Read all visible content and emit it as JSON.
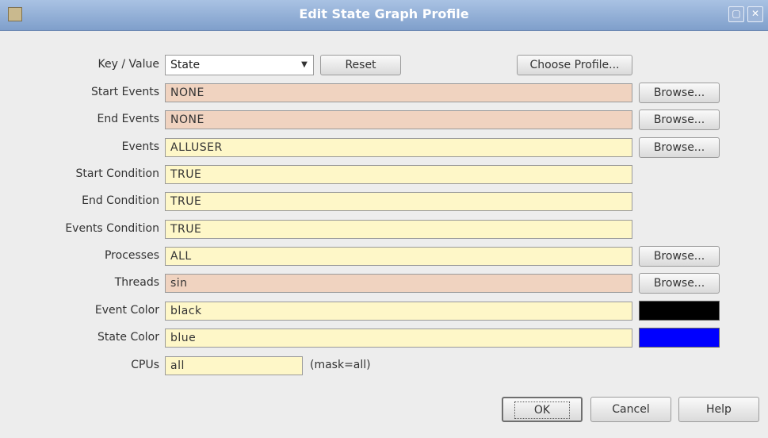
{
  "window": {
    "title": "Edit State Graph Profile"
  },
  "key_value": {
    "label": "Key / Value",
    "selected": "State"
  },
  "buttons": {
    "reset": "Reset",
    "choose_profile": "Choose Profile...",
    "browse": "Browse...",
    "ok": "OK",
    "cancel": "Cancel",
    "help": "Help"
  },
  "fields": {
    "start_events": {
      "label": "Start Events",
      "value": "NONE"
    },
    "end_events": {
      "label": "End Events",
      "value": "NONE"
    },
    "events": {
      "label": "Events",
      "value": "ALLUSER"
    },
    "start_condition": {
      "label": "Start Condition",
      "value": "TRUE"
    },
    "end_condition": {
      "label": "End Condition",
      "value": "TRUE"
    },
    "events_condition": {
      "label": "Events Condition",
      "value": "TRUE"
    },
    "processes": {
      "label": "Processes",
      "value": "ALL"
    },
    "threads": {
      "label": "Threads",
      "value": "sin"
    },
    "event_color": {
      "label": "Event Color",
      "value": "black"
    },
    "state_color": {
      "label": "State Color",
      "value": "blue"
    },
    "cpus": {
      "label": "CPUs",
      "value": "all",
      "mask": "(mask=all)"
    }
  },
  "colors": {
    "event_swatch": "#000000",
    "state_swatch": "#0000ff",
    "peach_field": "#f0d3c0",
    "yellow_field": "#fef7c8"
  }
}
